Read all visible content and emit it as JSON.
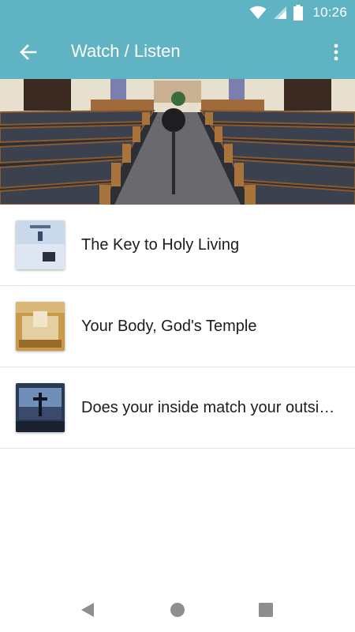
{
  "status_bar": {
    "time": "10:26",
    "icons": [
      "wifi-icon",
      "signal-icon",
      "battery-icon"
    ]
  },
  "app_bar": {
    "title": "Watch / Listen",
    "back_icon": "arrow-back-icon",
    "menu_icon": "more-vert-icon",
    "color": "#5fb3c3"
  },
  "hero": {
    "image": "church-sanctuary-pews-photo"
  },
  "list": {
    "items": [
      {
        "title": "The Key to Holy Living",
        "thumbnail": "sky-and-bible-thumbnail"
      },
      {
        "title": "Your Body, God's Temple",
        "thumbnail": "temple-model-thumbnail"
      },
      {
        "title": "Does your inside match your outside?",
        "thumbnail": "cross-on-screen-thumbnail"
      }
    ]
  },
  "nav_bar": {
    "icons": [
      "back-triangle-icon",
      "home-circle-icon",
      "recents-square-icon"
    ]
  }
}
